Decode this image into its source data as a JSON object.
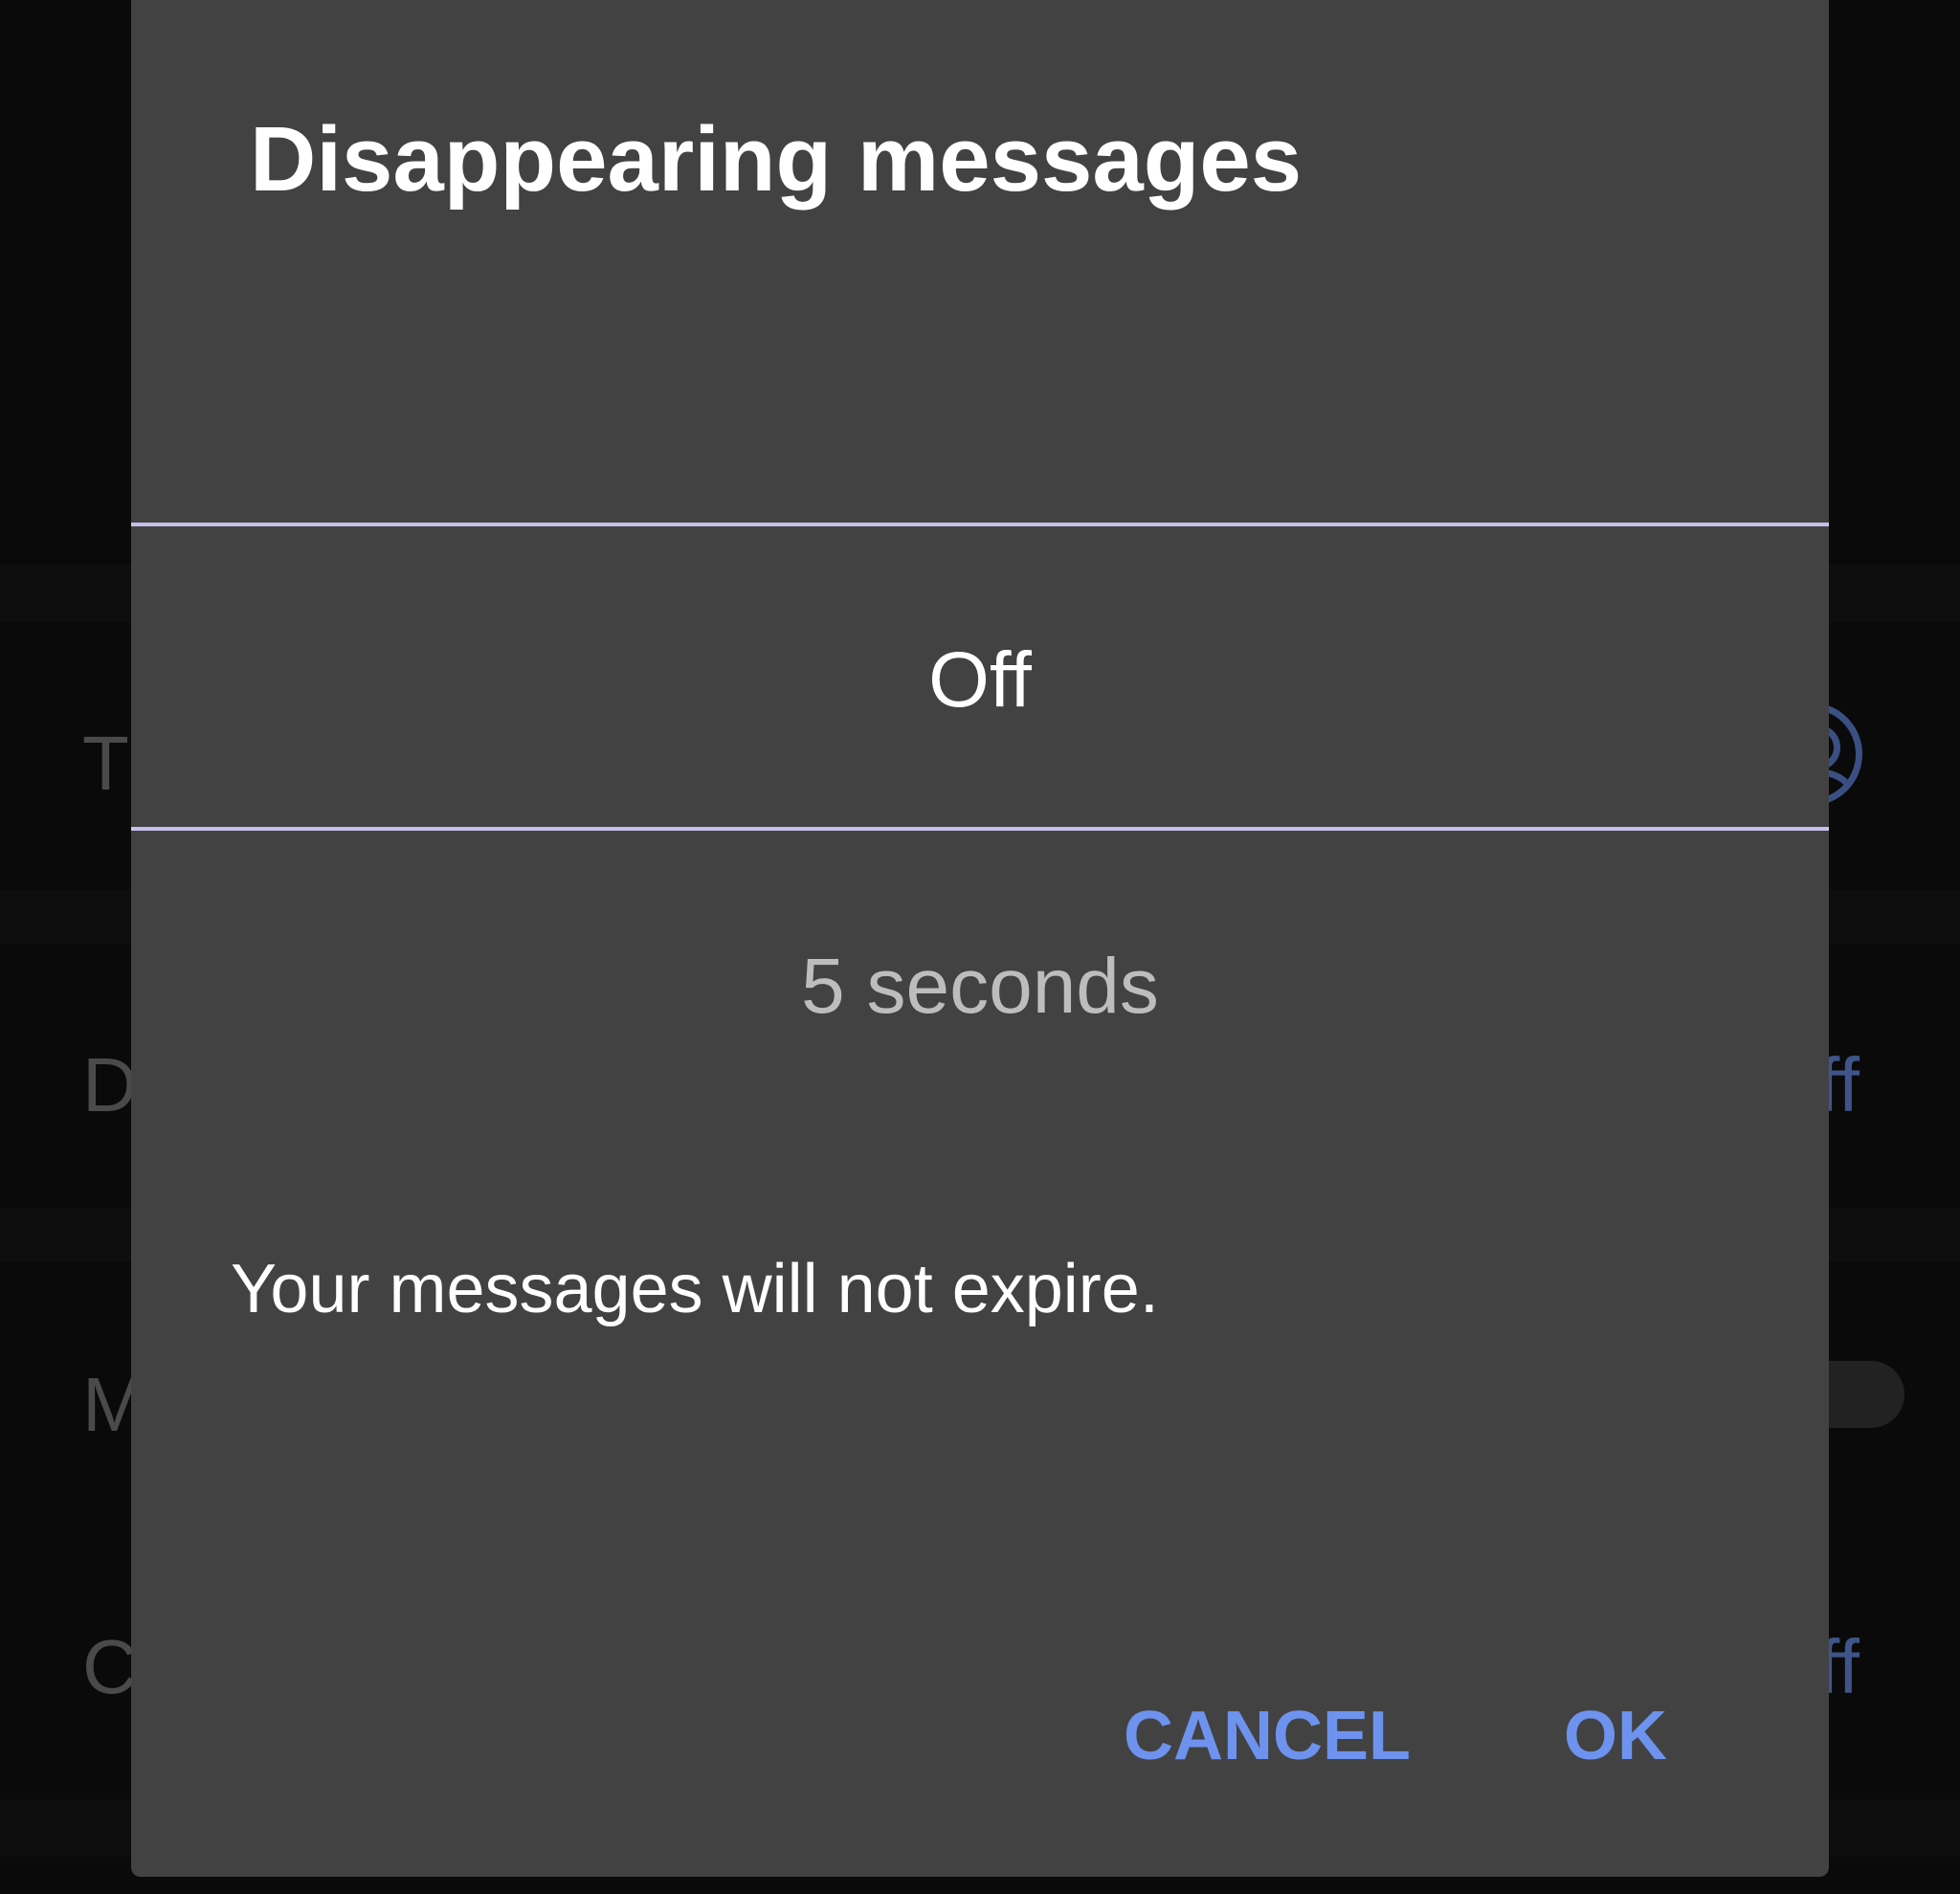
{
  "background": {
    "rows": [
      {
        "partial_label": "T",
        "trailing": "avatar-icon"
      },
      {
        "partial_label": "D",
        "partial_value": "ff"
      },
      {
        "partial_label": "M",
        "trailing": "toggle"
      },
      {
        "partial_label": "C",
        "partial_value": "ff"
      }
    ]
  },
  "dialog": {
    "title": "Disappearing messages",
    "picker": {
      "selected": "Off",
      "next": "5 seconds"
    },
    "message": "Your messages will not expire.",
    "buttons": {
      "cancel": "CANCEL",
      "ok": "OK"
    }
  },
  "colors": {
    "dialog_bg": "#424242",
    "accent": "#6d93ee",
    "divider": "#c5c0ea",
    "scrim": "#080808"
  }
}
